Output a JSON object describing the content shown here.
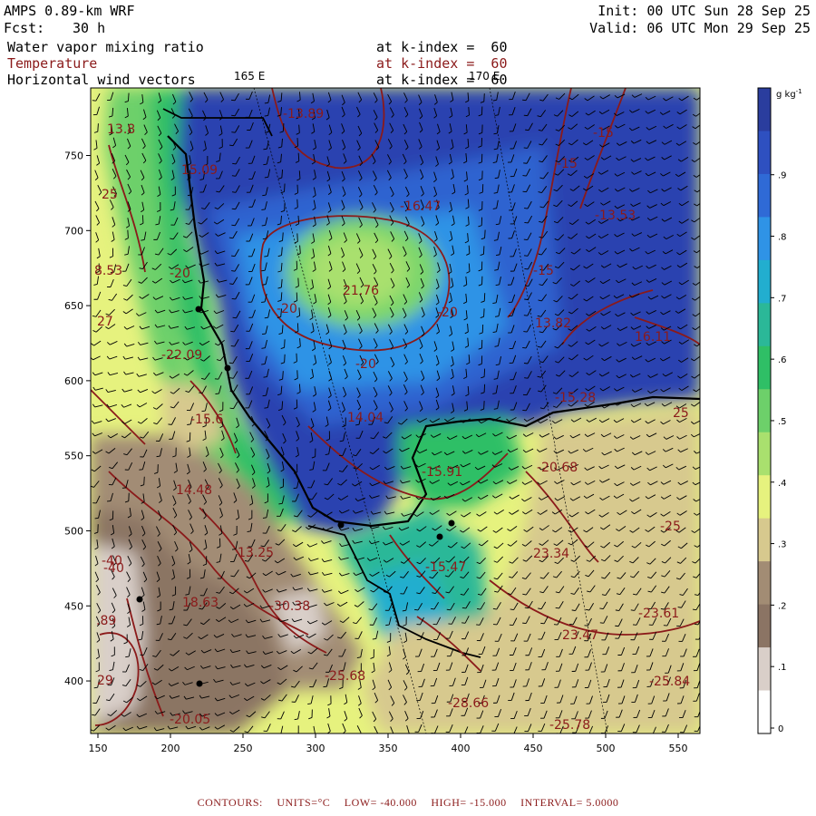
{
  "header": {
    "model": "AMPS 0.89-km WRF",
    "fcst_label": "Fcst:",
    "fcst_hours": "30 h",
    "init": "Init: 00 UTC Sun 28 Sep 25",
    "valid": "Valid: 06 UTC Mon 29 Sep 25"
  },
  "fields": [
    {
      "name": "Water vapor mixing ratio",
      "level": "at k-index =  60",
      "color": "#000000"
    },
    {
      "name": "Temperature",
      "level": "at k-index =  60",
      "color": "#8b1a1a"
    },
    {
      "name": "Horizontal wind vectors",
      "level": "at k-index =  60",
      "color": "#000000"
    }
  ],
  "longitude_labels": [
    "165 E",
    "170 E"
  ],
  "map": {
    "x_ticks": [
      "150",
      "200",
      "250",
      "300",
      "350",
      "400",
      "450",
      "500",
      "550"
    ],
    "y_ticks": [
      "750",
      "700",
      "650",
      "600",
      "550",
      "500",
      "450",
      "400"
    ],
    "x_range": [
      145,
      565
    ],
    "y_range": [
      365,
      795
    ]
  },
  "colorbar": {
    "unit": "g kg",
    "unit_exp": "-1",
    "labels": [
      ".9",
      ".8",
      ".7",
      ".6",
      ".5",
      ".4",
      ".3",
      ".2",
      ".1",
      "0"
    ],
    "colors": [
      "#2a3d9e",
      "#2e50c0",
      "#2f6ad6",
      "#2f93e6",
      "#22aecf",
      "#2bb898",
      "#2fbf66",
      "#6dd06a",
      "#a9e06e",
      "#e6f27e",
      "#d7c98e",
      "#a28c74",
      "#8b7464",
      "#d9cfc9",
      "#ffffff"
    ]
  },
  "contour_labels": [
    {
      "text": "13.8",
      "kind": "value"
    },
    {
      "text": "-13.89",
      "kind": "value"
    },
    {
      "text": "-15",
      "kind": "value"
    },
    {
      "text": "15.09",
      "kind": "value"
    },
    {
      "text": "-15",
      "kind": "value"
    },
    {
      "text": "-16.47",
      "kind": "value"
    },
    {
      "text": "-13.53",
      "kind": "value"
    },
    {
      "text": "25",
      "kind": "value"
    },
    {
      "text": "8.53",
      "kind": "value"
    },
    {
      "text": "-20",
      "kind": "value"
    },
    {
      "text": "-20",
      "kind": "value"
    },
    {
      "text": "21.76",
      "kind": "value"
    },
    {
      "text": "-20",
      "kind": "value"
    },
    {
      "text": "-15",
      "kind": "value"
    },
    {
      "text": "13.82",
      "kind": "value"
    },
    {
      "text": "16.11",
      "kind": "value"
    },
    {
      "text": "27",
      "kind": "value"
    },
    {
      "text": "-22.09",
      "kind": "value"
    },
    {
      "text": "-20",
      "kind": "value"
    },
    {
      "text": "-15.28",
      "kind": "value"
    },
    {
      "text": "-15.6",
      "kind": "value"
    },
    {
      "text": "14.04",
      "kind": "value"
    },
    {
      "text": "25",
      "kind": "value"
    },
    {
      "text": "-15.91",
      "kind": "value"
    },
    {
      "text": "-20.68",
      "kind": "value"
    },
    {
      "text": "14.48",
      "kind": "value"
    },
    {
      "text": "13.25",
      "kind": "value"
    },
    {
      "text": "23.34",
      "kind": "value"
    },
    {
      "text": "-25",
      "kind": "value"
    },
    {
      "text": "-40",
      "kind": "value"
    },
    {
      "text": "-15.47",
      "kind": "value"
    },
    {
      "text": "18.63",
      "kind": "value"
    },
    {
      "text": "-30.38",
      "kind": "value"
    },
    {
      "text": "-23.61",
      "kind": "value"
    },
    {
      "text": "23.47",
      "kind": "value"
    },
    {
      "text": ".89",
      "kind": "value"
    },
    {
      "text": "-40",
      "kind": "value"
    },
    {
      "text": "-25.68",
      "kind": "value"
    },
    {
      "text": "-25.84",
      "kind": "value"
    },
    {
      "text": "29",
      "kind": "value"
    },
    {
      "text": "-28.66",
      "kind": "value"
    },
    {
      "text": "-20.05",
      "kind": "value"
    },
    {
      "text": "-25.78",
      "kind": "value"
    }
  ],
  "footer": {
    "contours": "CONTOURS:",
    "units": "UNITS=°C",
    "low": "LOW= -40.000",
    "high": "HIGH= -15.000",
    "interval": "INTERVAL=    5.0000"
  }
}
